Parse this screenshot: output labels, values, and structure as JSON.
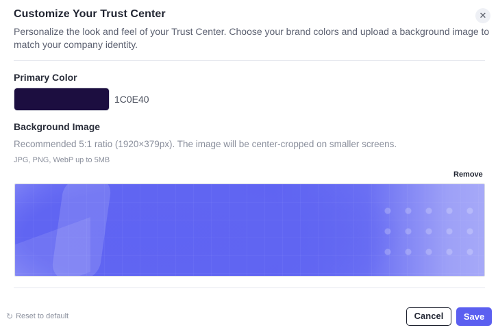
{
  "dialog": {
    "title": "Customize Your Trust Center",
    "close_icon": "close-icon",
    "close_glyph": "✕",
    "subtitle": "Personalize the look and feel of your Trust Center. Choose your brand colors and upload a background image to match your company identity."
  },
  "primary_color": {
    "label": "Primary Color",
    "hex_text": "1C0E40",
    "swatch_color": "#1C0E40"
  },
  "background_image": {
    "label": "Background Image",
    "hint": "Recommended 5:1 ratio (1920×379px). The image will be center-cropped on smaller screens.",
    "formats": "JPG, PNG, WebP up to 5MB",
    "remove_label": "Remove"
  },
  "footer": {
    "reset_icon": "reset-icon",
    "reset_glyph": "↻",
    "reset_label": "Reset to default",
    "cancel_label": "Cancel",
    "save_label": "Save"
  },
  "colors": {
    "accent": "#5B5FF0",
    "banner_primary": "#5F64F3"
  }
}
